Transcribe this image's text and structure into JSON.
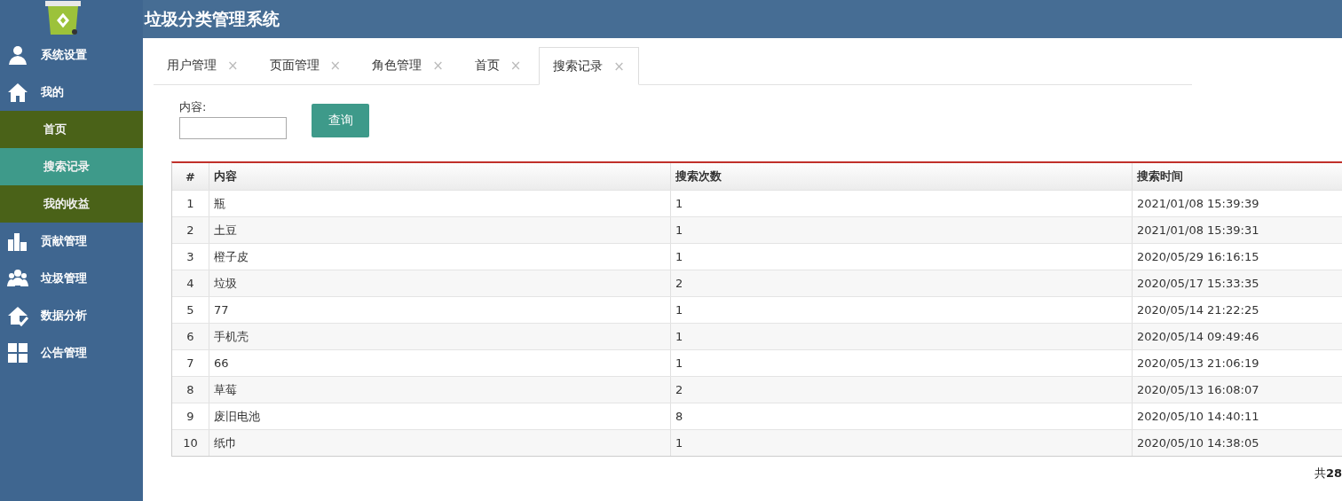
{
  "header": {
    "title": "垃圾分类管理系统"
  },
  "sidebar": {
    "items": [
      {
        "label": "系统设置"
      },
      {
        "label": "我的",
        "children": [
          {
            "label": "首页",
            "selected": false
          },
          {
            "label": "搜索记录",
            "selected": true
          },
          {
            "label": "我的收益",
            "selected": false
          }
        ]
      },
      {
        "label": "贡献管理"
      },
      {
        "label": "垃圾管理"
      },
      {
        "label": "数据分析"
      },
      {
        "label": "公告管理"
      }
    ]
  },
  "tabs": [
    {
      "label": "用户管理",
      "close": "×",
      "selected": false
    },
    {
      "label": "页面管理",
      "close": "×",
      "selected": false
    },
    {
      "label": "角色管理",
      "close": "×",
      "selected": false
    },
    {
      "label": "首页",
      "close": "×",
      "selected": false
    },
    {
      "label": "搜索记录",
      "close": "×",
      "selected": true
    }
  ],
  "search": {
    "label": "内容:",
    "button": "查询"
  },
  "table": {
    "columns": [
      "#",
      "内容",
      "搜索次数",
      "搜索时间"
    ],
    "rows": [
      [
        "1",
        "瓶",
        "1",
        "2021/01/08 15:39:39"
      ],
      [
        "2",
        "土豆",
        "1",
        "2021/01/08 15:39:31"
      ],
      [
        "3",
        "橙子皮",
        "1",
        "2020/05/29 16:16:15"
      ],
      [
        "4",
        "垃圾",
        "2",
        "2020/05/17 15:33:35"
      ],
      [
        "5",
        "77",
        "1",
        "2020/05/14 21:22:25"
      ],
      [
        "6",
        "手机壳",
        "1",
        "2020/05/14 09:49:46"
      ],
      [
        "7",
        "66",
        "1",
        "2020/05/13 21:06:19"
      ],
      [
        "8",
        "草莓",
        "2",
        "2020/05/13 16:08:07"
      ],
      [
        "9",
        "废旧电池",
        "8",
        "2020/05/10 14:40:11"
      ],
      [
        "10",
        "纸巾",
        "1",
        "2020/05/10 14:38:05"
      ]
    ]
  },
  "pagination": {
    "total": "共**28**"
  }
}
